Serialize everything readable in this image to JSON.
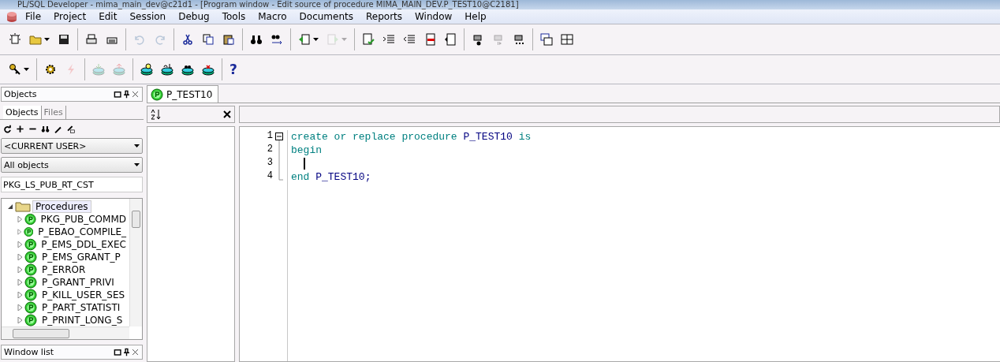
{
  "window": {
    "title": "PL/SQL Developer - mima_main_dev@c21d1 - [Program window - Edit source of procedure MIMA_MAIN_DEV.P_TEST10@C2181]"
  },
  "menu": [
    "File",
    "Project",
    "Edit",
    "Session",
    "Debug",
    "Tools",
    "Macro",
    "Documents",
    "Reports",
    "Window",
    "Help"
  ],
  "toolbar_1": [
    {
      "kind": "button",
      "disabled": false
    },
    {
      "kind": "dropdown",
      "disabled": false
    },
    {
      "kind": "button",
      "disabled": false
    },
    {
      "kind": "separator"
    },
    {
      "kind": "button",
      "disabled": false
    },
    {
      "kind": "button",
      "disabled": false
    },
    {
      "kind": "separator"
    },
    {
      "kind": "button",
      "disabled": true
    },
    {
      "kind": "button",
      "disabled": true
    },
    {
      "kind": "separator"
    },
    {
      "kind": "button",
      "disabled": false
    },
    {
      "kind": "button",
      "disabled": false
    },
    {
      "kind": "button",
      "disabled": false
    },
    {
      "kind": "separator"
    },
    {
      "kind": "button",
      "disabled": false
    },
    {
      "kind": "button",
      "disabled": false
    },
    {
      "kind": "separator"
    },
    {
      "kind": "dropdown",
      "disabled": false
    },
    {
      "kind": "dropdown",
      "disabled": true
    },
    {
      "kind": "separator"
    },
    {
      "kind": "button",
      "disabled": false
    },
    {
      "kind": "button",
      "disabled": false
    },
    {
      "kind": "button",
      "disabled": false
    },
    {
      "kind": "button",
      "disabled": false
    },
    {
      "kind": "button",
      "disabled": false
    },
    {
      "kind": "separator"
    },
    {
      "kind": "button",
      "disabled": false
    },
    {
      "kind": "button",
      "disabled": true
    },
    {
      "kind": "button",
      "disabled": false
    },
    {
      "kind": "separator"
    },
    {
      "kind": "button",
      "disabled": false
    },
    {
      "kind": "button",
      "disabled": false
    }
  ],
  "toolbar_2": [
    {
      "kind": "dropdown",
      "disabled": false
    },
    {
      "kind": "separator"
    },
    {
      "kind": "button",
      "disabled": false
    },
    {
      "kind": "button",
      "disabled": true
    },
    {
      "kind": "separator"
    },
    {
      "kind": "button",
      "disabled": true
    },
    {
      "kind": "button",
      "disabled": true
    },
    {
      "kind": "separator"
    },
    {
      "kind": "button",
      "disabled": false
    },
    {
      "kind": "button",
      "disabled": false
    },
    {
      "kind": "button",
      "disabled": false
    },
    {
      "kind": "button",
      "disabled": false
    },
    {
      "kind": "separator"
    },
    {
      "kind": "text",
      "disabled": false,
      "label": "?"
    }
  ],
  "objects_panel": {
    "title": "Objects",
    "tabs": [
      {
        "label": "Objects",
        "selected": true
      },
      {
        "label": "Files",
        "selected": false
      }
    ],
    "user_select": "<CURRENT USER>",
    "type_select": "All objects",
    "filter": "PKG_LS_PUB_RT_CST",
    "tree": [
      {
        "label": "Procedures",
        "expanded": true,
        "children": [
          {
            "label": "PKG_PUB_COMMD",
            "expanded": false
          },
          {
            "label": "P_EBAO_COMPILE_",
            "expanded": false
          },
          {
            "label": "P_EMS_DDL_EXEC",
            "expanded": false
          },
          {
            "label": "P_EMS_GRANT_P",
            "expanded": false
          },
          {
            "label": "P_ERROR",
            "expanded": false
          },
          {
            "label": "P_GRANT_PRIVI",
            "expanded": false
          },
          {
            "label": "P_KILL_USER_SES",
            "expanded": false
          },
          {
            "label": "P_PART_STATISTI",
            "expanded": false
          },
          {
            "label": "P_PRINT_LONG_S",
            "expanded": false
          }
        ]
      }
    ]
  },
  "window_list": {
    "title": "Window list"
  },
  "editor_tabs": [
    {
      "label": "P_TEST10",
      "selected": true
    }
  ],
  "editor": {
    "lines": [
      {
        "number": "1",
        "tokens": [
          {
            "kind": "keyword",
            "text": "create or replace procedure "
          },
          {
            "kind": "identifier",
            "text": "P_TEST10 "
          },
          {
            "kind": "keyword",
            "text": "is"
          }
        ]
      },
      {
        "number": "2",
        "tokens": [
          {
            "kind": "keyword",
            "text": "begin"
          }
        ]
      },
      {
        "number": "3",
        "cursor": true
      },
      {
        "number": "4",
        "tokens": [
          {
            "kind": "keyword",
            "text": "end "
          },
          {
            "kind": "identifier",
            "text": "P_TEST10;"
          }
        ]
      }
    ]
  }
}
